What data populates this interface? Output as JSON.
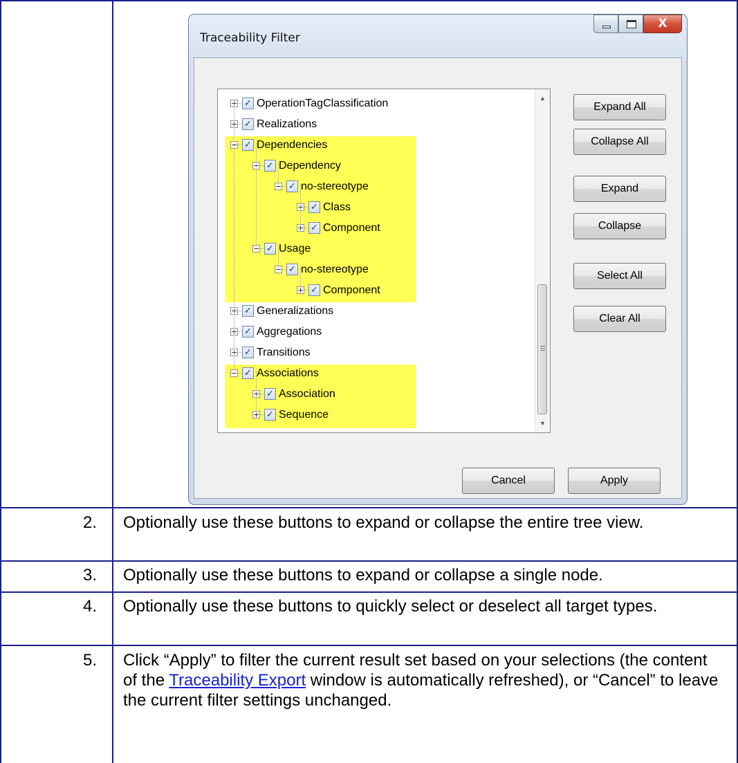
{
  "dialog": {
    "title": "Traceability Filter",
    "window_buttons": {
      "minimize": "minimize",
      "maximize": "maximize",
      "close": "X"
    },
    "tree": [
      {
        "label": "OperationTagClassification",
        "expander": "+",
        "checked": true
      },
      {
        "label": "Realizations",
        "expander": "+",
        "checked": true
      },
      {
        "label": "Dependencies",
        "expander": "−",
        "checked": true
      },
      {
        "label": "Dependency",
        "expander": "−",
        "checked": true
      },
      {
        "label": "no-stereotype",
        "expander": "−",
        "checked": true
      },
      {
        "label": "Class",
        "expander": "+",
        "checked": true
      },
      {
        "label": "Component",
        "expander": "+",
        "checked": true
      },
      {
        "label": "Usage",
        "expander": "−",
        "checked": true
      },
      {
        "label": "no-stereotype",
        "expander": "−",
        "checked": true
      },
      {
        "label": "Component",
        "expander": "+",
        "checked": true
      },
      {
        "label": "Generalizations",
        "expander": "+",
        "checked": true
      },
      {
        "label": "Aggregations",
        "expander": "+",
        "checked": true
      },
      {
        "label": "Transitions",
        "expander": "+",
        "checked": true
      },
      {
        "label": "Associations",
        "expander": "−",
        "checked": true
      },
      {
        "label": "Association",
        "expander": "+",
        "checked": true
      },
      {
        "label": "Sequence",
        "expander": "+",
        "checked": true
      }
    ],
    "checkmark": "✓",
    "scrollbar": {
      "up_arrow": "▲",
      "down_arrow": "▼"
    },
    "buttons": {
      "expand_all": "Expand All",
      "collapse_all": "Collapse All",
      "expand": "Expand",
      "collapse": "Collapse",
      "select_all": "Select All",
      "clear_all": "Clear All",
      "cancel": "Cancel",
      "apply": "Apply"
    },
    "highlight_color": "#ffff55"
  },
  "steps": [
    {
      "num": "2.",
      "text": "Optionally use these buttons to expand or collapse the entire tree view."
    },
    {
      "num": "3.",
      "text": "Optionally use these buttons to expand or collapse a single node."
    },
    {
      "num": "4.",
      "text": "Optionally use these buttons to quickly select or deselect all target types."
    },
    {
      "num": "5.",
      "text_before": "Click “Apply” to filter the current result set based on your selections (the content of the ",
      "link": "Traceability Export",
      "text_after": " window is automatically refreshed), or “Cancel” to leave the current filter settings unchanged."
    }
  ],
  "colors": {
    "table_border": "#1a1f8c",
    "link": "#1a22cc"
  }
}
